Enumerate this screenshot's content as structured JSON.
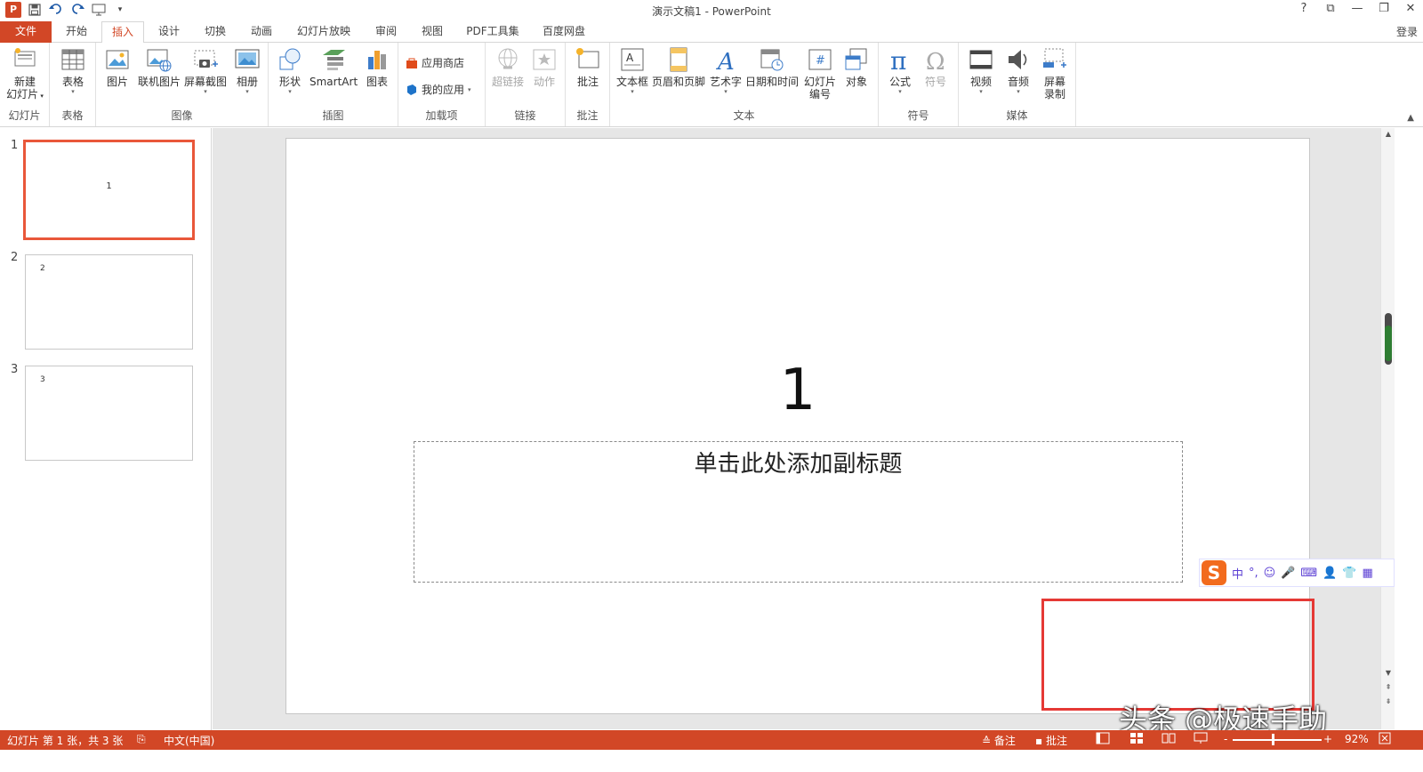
{
  "window": {
    "title": "演示文稿1 - PowerPoint",
    "controls": [
      "?",
      "⧉",
      "—",
      "❐",
      "✕"
    ]
  },
  "qat": {
    "logo": "P"
  },
  "tabs": [
    {
      "label": "文件"
    },
    {
      "label": "开始"
    },
    {
      "label": "插入"
    },
    {
      "label": "设计"
    },
    {
      "label": "切换"
    },
    {
      "label": "动画"
    },
    {
      "label": "幻灯片放映"
    },
    {
      "label": "审阅"
    },
    {
      "label": "视图"
    },
    {
      "label": "PDF工具集"
    },
    {
      "label": "百度网盘"
    }
  ],
  "login": "登录",
  "ribbon": {
    "slides": {
      "label": "幻灯片",
      "new_slide_l1": "新建",
      "new_slide_l2": "幻灯片"
    },
    "tables": {
      "label": "表格",
      "table": "表格"
    },
    "images": {
      "label": "图像",
      "picture": "图片",
      "online_picture": "联机图片",
      "screenshot": "屏幕截图",
      "album": "相册"
    },
    "illustrations": {
      "label": "插图",
      "shapes": "形状",
      "smartart": "SmartArt",
      "chart": "图表"
    },
    "addins": {
      "label": "加载项",
      "store": "应用商店",
      "my_apps": "我的应用"
    },
    "links": {
      "label": "链接",
      "hyperlink": "超链接",
      "action": "动作"
    },
    "comments": {
      "label": "批注",
      "comment": "批注"
    },
    "text": {
      "label": "文本",
      "textbox": "文本框",
      "header_footer": "页眉和页脚",
      "wordart": "艺术字",
      "datetime": "日期和时间",
      "slide_number_l1": "幻灯片",
      "slide_number_l2": "编号",
      "object": "对象"
    },
    "symbols": {
      "label": "符号",
      "equation": "公式",
      "symbol": "符号"
    },
    "media": {
      "label": "媒体",
      "video": "视频",
      "audio": "音频",
      "screen_record_l1": "屏幕",
      "screen_record_l2": "录制"
    }
  },
  "thumbnails": [
    {
      "num": "1",
      "text": "1"
    },
    {
      "num": "2",
      "text": "2"
    },
    {
      "num": "3",
      "text": "3"
    }
  ],
  "slide": {
    "title": "1",
    "subtitle_placeholder": "单击此处添加副标题"
  },
  "ime": {
    "logo": "S",
    "items": [
      "中",
      "°,",
      "☺",
      "🎤",
      "⌨",
      "👤",
      "👕",
      "▦"
    ]
  },
  "watermark": "头条 @极速手助",
  "status": {
    "slide_info": "幻灯片 第 1 张，共 3 张",
    "language": "中文(中国)",
    "notes": "备注",
    "comments": "批注",
    "zoom_minus": "-",
    "zoom_plus": "+",
    "zoom": "92%"
  },
  "colors": {
    "accent": "#d24726",
    "selection": "#e9573a",
    "highlight_box": "#e53935"
  }
}
